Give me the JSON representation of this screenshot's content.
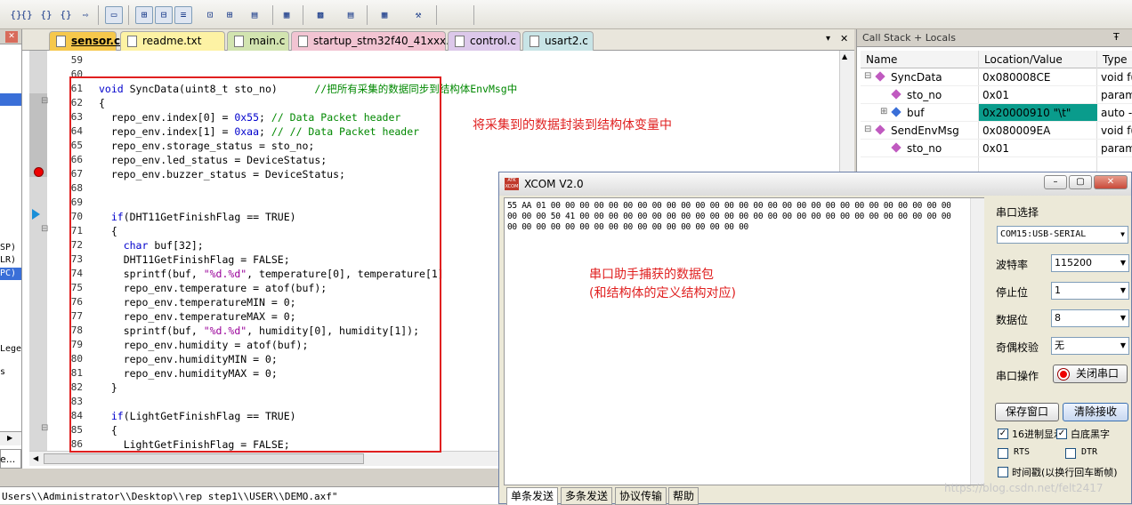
{
  "toolbar": {
    "icons": [
      "braces-in-icon",
      "braces-out-icon",
      "braces-step-icon",
      "braces-run-icon",
      "run-to-cursor-icon",
      "command-window-icon",
      "disassembly-icon",
      "symbols-icon",
      "registers-icon",
      "call-stack-icon",
      "watch-icon",
      "memory-icon",
      "serial-icon",
      "analysis-icon",
      "trace-icon",
      "system-viewer-icon",
      "toolbox-icon"
    ],
    "glyphs": [
      "{}",
      "{}",
      "{}",
      "{}",
      "⇨",
      "▭",
      "⊞",
      "⊟",
      "≡",
      "⊡",
      "⊞",
      "▤",
      "▦",
      "▩",
      "▤",
      "▦",
      "⚒"
    ]
  },
  "editor": {
    "tabs": [
      {
        "label": "sensor.c",
        "color": "#f6c84c",
        "active": true
      },
      {
        "label": "readme.txt",
        "color": "#fdf2a4",
        "active": false
      },
      {
        "label": "main.c",
        "color": "#d2e4b0",
        "active": false
      },
      {
        "label": "startup_stm32f40_41xxx.s",
        "color": "#f2c4d2",
        "active": false
      },
      {
        "label": "control.c",
        "color": "#dcc8ea",
        "active": false
      },
      {
        "label": "usart2.c",
        "color": "#c8e4e6",
        "active": false
      }
    ],
    "close_glyph": "✕",
    "pin_glyph": "▾",
    "line_numbers": [
      "59",
      "60",
      "61",
      "62",
      "63",
      "64",
      "65",
      "66",
      "67",
      "68",
      "69",
      "70",
      "71",
      "72",
      "73",
      "74",
      "75",
      "76",
      "77",
      "78",
      "79",
      "80",
      "81",
      "82",
      "83",
      "84",
      "85",
      "86"
    ],
    "code_lines": [
      "",
      "",
      "void SyncData(uint8_t sto_no)      //把所有采集的数据同步到结构体EnvMsg中",
      "{",
      "  repo_env.index[0] = 0x55; // Data Packet header",
      "  repo_env.index[1] = 0xaa; // // Data Packet header",
      "  repo_env.storage_status = sto_no;",
      "  repo_env.led_status = DeviceStatus;",
      "  repo_env.buzzer_status = DeviceStatus;",
      "",
      "",
      "  if(DHT11GetFinishFlag == TRUE)",
      "  {",
      "    char buf[32];",
      "    DHT11GetFinishFlag = FALSE;",
      "    sprintf(buf, \"%d.%d\", temperature[0], temperature[1]",
      "    repo_env.temperature = atof(buf);",
      "    repo_env.temperatureMIN = 0;",
      "    repo_env.temperatureMAX = 0;",
      "    sprintf(buf, \"%d.%d\", humidity[0], humidity[1]);",
      "    repo_env.humidity = atof(buf);",
      "    repo_env.humidityMIN = 0;",
      "    repo_env.humidityMAX = 0;",
      "  }",
      "",
      "  if(LightGetFinishFlag == TRUE)",
      "  {",
      "    LightGetFinishFlag = FALSE;"
    ],
    "annotation": "将采集到的数据封装到结构体变量中",
    "annotation_color": "#e02020"
  },
  "left_panel": {
    "fragments": [
      "SP)",
      "LR)",
      "PC)",
      "Lege",
      "s",
      "e..."
    ]
  },
  "call_stack": {
    "title": "Call Stack + Locals",
    "pin": "Ŧ",
    "columns": [
      "Name",
      "Location/Value",
      "Type"
    ],
    "rows": [
      {
        "name": "SyncData",
        "value": "0x080008CE",
        "type": "void f(",
        "expander": "⊟",
        "highlight": false
      },
      {
        "name": "sto_no",
        "value": "0x01",
        "type": "param",
        "expander": "",
        "highlight": false
      },
      {
        "name": "buf",
        "value": "0x20000910 \"\\t\"",
        "type": "auto -",
        "expander": "⊞",
        "highlight": true
      },
      {
        "name": "SendEnvMsg",
        "value": "0x080009EA",
        "type": "void f(",
        "expander": "⊟",
        "highlight": false
      },
      {
        "name": "sto_no",
        "value": "0x01",
        "type": "param",
        "expander": "",
        "highlight": false
      }
    ]
  },
  "status_path": "Users\\\\Administrator\\\\Desktop\\\\rep step1\\\\USER\\\\DEMO.axf\"",
  "xcom": {
    "title": "XCOM V2.0",
    "logo": "ATK XCOM",
    "window_buttons": [
      "–",
      "▢",
      "✕"
    ],
    "received_hex": [
      "55 AA 01 00 00 00 00 00 00 00 00 00 00 00 00 00 00 00 00 00 00 00 00 00 00 00 00 00 00 00 00",
      "00 00 00 50 41 00 00 00 00 00 00 00 00 00 00 00 00 00 00 00 00 00 00 00 00 00 00 00 00 00 00",
      "00 00 00 00 00 00 00 00 00 00 00 00 00 00 00 00 00"
    ],
    "note_line1": "串口助手捕获的数据包",
    "note_line2": "(和结构体的定义结构对应)",
    "note_color": "#e02020",
    "settings": [
      {
        "label": "串口选择",
        "value": ""
      },
      {
        "label": "",
        "value": "COM15:USB-SERIAL"
      },
      {
        "label": "波特率",
        "value": "115200"
      },
      {
        "label": "停止位",
        "value": "1"
      },
      {
        "label": "数据位",
        "value": "8"
      },
      {
        "label": "奇偶校验",
        "value": "无"
      }
    ],
    "port_op_label": "串口操作",
    "close_port_btn": "关闭串口",
    "save_window_btn": "保存窗口",
    "clear_rx_btn": "清除接收",
    "check_hex": {
      "label": "16进制显示",
      "checked": true
    },
    "check_white": {
      "label": "白底黑字",
      "checked": true
    },
    "check_rts": {
      "label": "RTS",
      "checked": false
    },
    "check_dtr": {
      "label": "DTR",
      "checked": false
    },
    "check_timestamp": {
      "label": "时间戳(以换行回车断帧)",
      "checked": false
    },
    "bottom_tabs": [
      "单条发送",
      "多条发送",
      "协议传输",
      "帮助"
    ],
    "watermark": "https://blog.csdn.net/felt2417"
  }
}
